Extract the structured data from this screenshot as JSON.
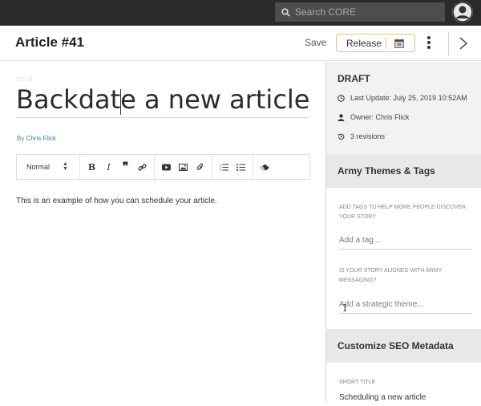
{
  "topbar": {
    "search_placeholder": "Search CORE",
    "search_icon": "search-icon",
    "avatar_icon": "user-avatar-icon"
  },
  "header": {
    "title": "Article #41",
    "save_label": "Save",
    "release_label": "Release",
    "calendar_icon": "calendar-icon",
    "menu_icon": "kebab-menu-icon",
    "next_icon": "chevron-right-icon"
  },
  "editor": {
    "title_label": "TITLE",
    "title_before_caret": "Backdate",
    "title_after_caret": " a new article",
    "by_prefix": "By",
    "author": "Chris Flick",
    "format_select": "Normal",
    "toolbar_icons": [
      "bold-icon",
      "italic-icon",
      "quote-icon",
      "link-icon",
      "video-icon",
      "image-icon",
      "attachment-icon",
      "ordered-list-icon",
      "bullet-list-icon",
      "clear-format-icon"
    ],
    "body": "This is an example of how you can schedule your article."
  },
  "sidebar": {
    "status": "DRAFT",
    "last_update": "Last Update: July 25, 2019 10:52AM",
    "owner": "Owner: Chris Flick",
    "revisions": "3 revisions",
    "themes_title": "Army Themes & Tags",
    "tags_label": "ADD TAGS TO HELP MORE PEOPLE DISCOVER YOUR STORY",
    "tags_placeholder": "Add a tag...",
    "theme_label": "IS YOUR STORY ALIGNED WITH ARMY MESSAGING?",
    "theme_placeholder": "Add a strategic theme...",
    "seo_title": "Customize SEO Metadata",
    "short_title_label": "SHORT TITLE",
    "short_title_value": "Scheduling a new article"
  },
  "colors": {
    "topbar": "#2a2a2a",
    "release_border": "#e3c178",
    "link": "#3e7fb6",
    "sidebar_panel": "#f2f2f2"
  }
}
